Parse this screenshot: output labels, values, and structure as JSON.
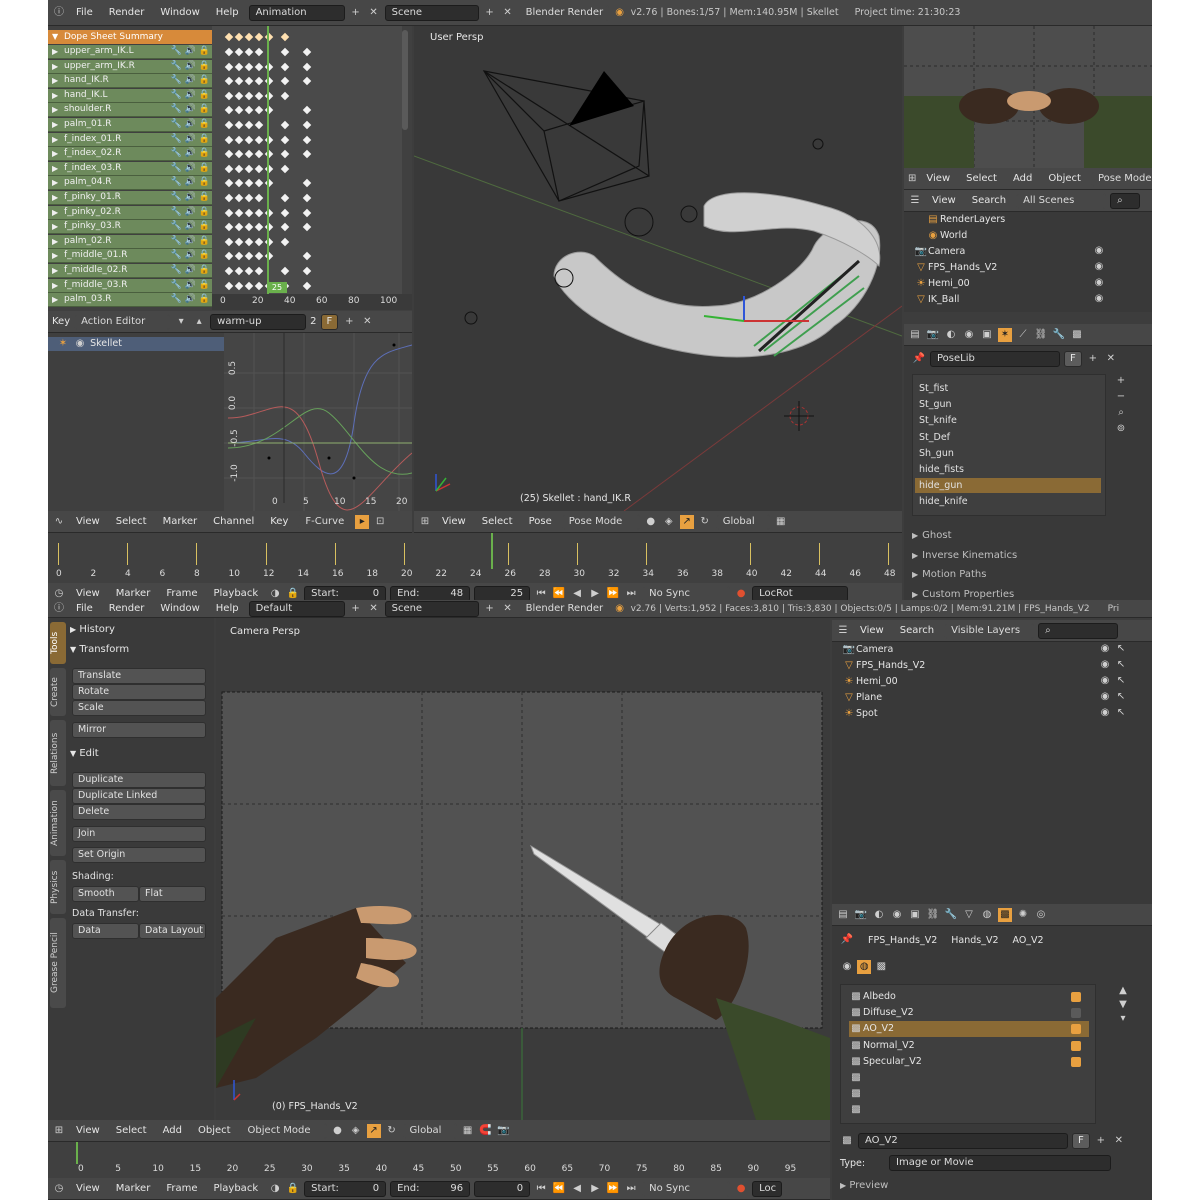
{
  "top_info": {
    "menus": [
      "File",
      "Render",
      "Window",
      "Help"
    ],
    "layout": "Animation",
    "scene": "Scene",
    "engine": "Blender Render",
    "stats": "v2.76 | Bones:1/57 | Mem:140.95M | Skellet",
    "project_time": "Project time: 21:30:23"
  },
  "dope_sheet": {
    "summary": "Dope Sheet Summary",
    "channels": [
      "upper_arm_IK.L",
      "upper_arm_IK.R",
      "hand_IK.R",
      "hand_IK.L",
      "shoulder.R",
      "palm_01.R",
      "f_index_01.R",
      "f_index_02.R",
      "f_index_03.R",
      "palm_04.R",
      "f_pinky_01.R",
      "f_pinky_02.R",
      "f_pinky_03.R",
      "palm_02.R",
      "f_middle_01.R",
      "f_middle_02.R",
      "f_middle_03.R",
      "palm_03.R"
    ],
    "frame_ticks": [
      "0",
      "20",
      "40",
      "60",
      "80",
      "100"
    ],
    "current_frame": "25",
    "editor": "Action Editor",
    "action": "warm-up",
    "users": "2",
    "fake_user": "F",
    "key_label": "Key"
  },
  "graph": {
    "object": "Skellet",
    "y_ticks": [
      "0.5",
      "0.0",
      "-0.5",
      "-1.0"
    ],
    "x_ticks": [
      "0",
      "5",
      "10",
      "15",
      "20"
    ],
    "menus": [
      "View",
      "Select",
      "Marker",
      "Channel",
      "Key"
    ],
    "mode": "F-Curve"
  },
  "viewport_top": {
    "label": "User Persp",
    "status": "(25) Skellet : hand_IK.R",
    "menus": [
      "View",
      "Select",
      "Pose"
    ],
    "mode": "Pose Mode",
    "orientation": "Global"
  },
  "timeline_top": {
    "ticks": [
      "0",
      "2",
      "4",
      "6",
      "8",
      "10",
      "12",
      "14",
      "16",
      "18",
      "20",
      "22",
      "24",
      "26",
      "28",
      "30",
      "32",
      "34",
      "36",
      "38",
      "40",
      "42",
      "44",
      "46",
      "48"
    ],
    "menus": [
      "View",
      "Marker",
      "Frame",
      "Playback"
    ],
    "start_label": "Start:",
    "start": "0",
    "end_label": "End:",
    "end": "48",
    "current": "25",
    "sync": "No Sync",
    "keying": "LocRot"
  },
  "top_right": {
    "menus": [
      "View",
      "Select",
      "Add",
      "Object"
    ],
    "mode": "Pose Mode",
    "outliner_menus": [
      "View",
      "Search"
    ],
    "outliner_filter": "All Scenes",
    "outliner_items": [
      "RenderLayers",
      "World",
      "Camera",
      "FPS_Hands_V2",
      "Hemi_00",
      "IK_Ball"
    ],
    "poselib_name": "PoseLib",
    "poselib_f": "F",
    "poses": [
      "St_fist",
      "St_gun",
      "St_knife",
      "St_Def",
      "Sh_gun",
      "hide_fists",
      "hide_gun",
      "hide_knife"
    ],
    "selected_pose": "hide_gun",
    "sections": [
      "Ghost",
      "Inverse Kinematics",
      "Motion Paths",
      "Custom Properties"
    ]
  },
  "bottom_info": {
    "menus": [
      "File",
      "Render",
      "Window",
      "Help"
    ],
    "layout": "Default",
    "scene": "Scene",
    "engine": "Blender Render",
    "stats": "v2.76 | Verts:1,952 | Faces:3,810 | Tris:3,830 | Objects:0/5 | Lamps:0/2 | Mem:91.21M | FPS_Hands_V2",
    "overflow": "Pri"
  },
  "tools": {
    "tabs": [
      "Tools",
      "Create",
      "Relations",
      "Animation",
      "Physics",
      "Grease Pencil"
    ],
    "history": "History",
    "transform": "Transform",
    "transform_items": [
      "Translate",
      "Rotate",
      "Scale",
      "Mirror"
    ],
    "edit": "Edit",
    "edit_items": [
      "Duplicate",
      "Duplicate Linked",
      "Delete",
      "Join",
      "Set Origin"
    ],
    "shading_label": "Shading:",
    "smooth": "Smooth",
    "flat": "Flat",
    "transfer_label": "Data Transfer:",
    "data": "Data",
    "data_layout": "Data Layout"
  },
  "viewport_bottom": {
    "label": "Camera Persp",
    "status": "(0) FPS_Hands_V2",
    "menus": [
      "View",
      "Select",
      "Add",
      "Object"
    ],
    "mode": "Object Mode",
    "orientation": "Global"
  },
  "timeline_bottom": {
    "ticks": [
      "0",
      "5",
      "10",
      "15",
      "20",
      "25",
      "30",
      "35",
      "40",
      "45",
      "50",
      "55",
      "60",
      "65",
      "70",
      "75",
      "80",
      "85",
      "90",
      "95"
    ],
    "menus": [
      "View",
      "Marker",
      "Frame",
      "Playback"
    ],
    "start_label": "Start:",
    "start": "0",
    "end_label": "End:",
    "end": "96",
    "current": "0",
    "sync": "No Sync",
    "keying": "Loc"
  },
  "bottom_right": {
    "outliner_menus": [
      "View",
      "Search"
    ],
    "outliner_filter": "Visible Layers",
    "outliner_items": [
      "Camera",
      "FPS_Hands_V2",
      "Hemi_00",
      "Plane",
      "Spot"
    ],
    "context": [
      "FPS_Hands_V2",
      "Hands_V2",
      "AO_V2"
    ],
    "textures": [
      {
        "name": "Albedo",
        "checked": true
      },
      {
        "name": "Diffuse_V2",
        "checked": false
      },
      {
        "name": "AO_V2",
        "checked": true
      },
      {
        "name": "Normal_V2",
        "checked": true
      },
      {
        "name": "Specular_V2",
        "checked": true
      }
    ],
    "texture_name": "AO_V2",
    "texture_f": "F",
    "type_label": "Type:",
    "type_value": "Image or Movie",
    "preview": "Preview"
  },
  "colors": {
    "selected": "#8a6a35",
    "summary": "#d78a3a",
    "channel": "#6d8a5c",
    "frame_cursor": "#6ab04c",
    "accent": "#e8a040"
  }
}
